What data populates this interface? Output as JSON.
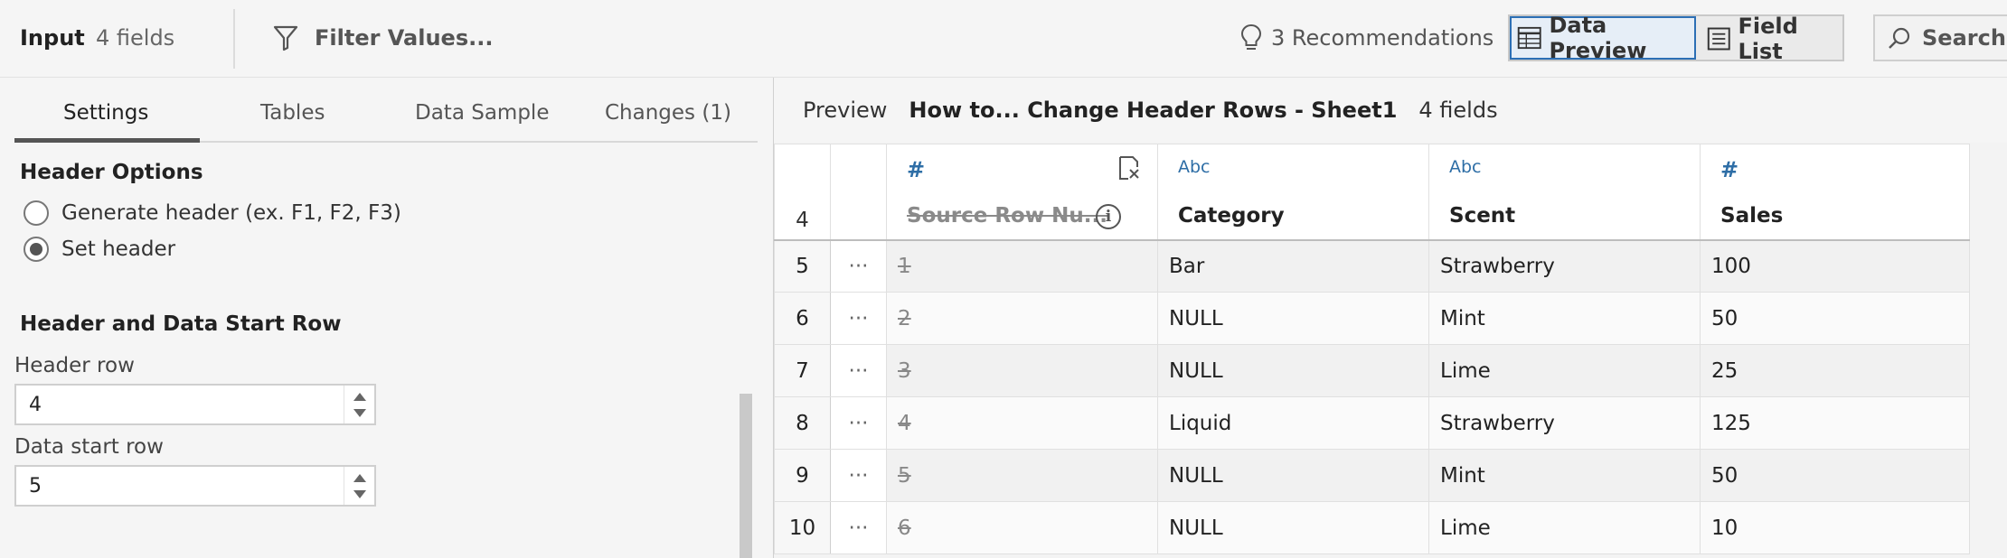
{
  "topbar": {
    "title": "Input",
    "field_count": "4 fields",
    "filter_label": "Filter Values...",
    "recommendations": "3 Recommendations",
    "data_preview": "Data Preview",
    "field_list": "Field List",
    "search": "Search"
  },
  "settings": {
    "tabs": [
      {
        "label": "Settings",
        "active": true
      },
      {
        "label": "Tables"
      },
      {
        "label": "Data Sample"
      },
      {
        "label": "Changes (1)"
      }
    ],
    "header_options_title": "Header Options",
    "radio_generate": "Generate header (ex. F1, F2, F3)",
    "radio_set": "Set header",
    "selected_option": "Set header",
    "start_row_title": "Header and Data Start Row",
    "header_row_label": "Header row",
    "header_row_value": "4",
    "data_start_label": "Data start row",
    "data_start_value": "5"
  },
  "preview": {
    "label": "Preview",
    "source_name": "How to... Change Header Rows - Sheet1",
    "field_count": "4 fields",
    "header_row_number": "4",
    "columns": [
      {
        "type": "#",
        "name": "Source Row Nu...",
        "removed": true
      },
      {
        "type": "Abc",
        "name": "Category"
      },
      {
        "type": "Abc",
        "name": "Scent"
      },
      {
        "type": "#",
        "name": "Sales"
      }
    ],
    "rows": [
      {
        "num": "5",
        "menu": "···",
        "source": "1",
        "category": "Bar",
        "scent": "Strawberry",
        "sales": "100"
      },
      {
        "num": "6",
        "menu": "···",
        "source": "2",
        "category": "NULL",
        "scent": "Mint",
        "sales": "50"
      },
      {
        "num": "7",
        "menu": "···",
        "source": "3",
        "category": "NULL",
        "scent": "Lime",
        "sales": "25"
      },
      {
        "num": "8",
        "menu": "···",
        "source": "4",
        "category": "Liquid",
        "scent": "Strawberry",
        "sales": "125"
      },
      {
        "num": "9",
        "menu": "···",
        "source": "5",
        "category": "NULL",
        "scent": "Mint",
        "sales": "50"
      },
      {
        "num": "10",
        "menu": "···",
        "source": "6",
        "category": "NULL",
        "scent": "Lime",
        "sales": "10"
      }
    ]
  }
}
